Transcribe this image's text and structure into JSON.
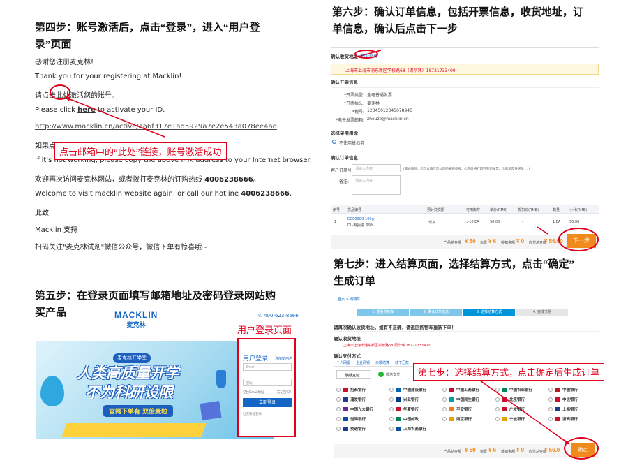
{
  "left": {
    "step4_heading": "第四步：账号激活后，点击“登录”，进入“用户登录”页面",
    "step4_line1": "第四步：账号激活后，点击“登录”，进入“用户登",
    "step4_line2": "录”页面",
    "email": {
      "greeting_cn": "感谢您注册麦克林!",
      "greeting_en": "Thank you for your registering at Macklin!",
      "click_cn_pre": "请点击",
      "click_cn_link": "此处",
      "click_cn_post": "激活您的账号。",
      "click_en_pre": "Please click ",
      "click_en_link": "here",
      "click_en_post": " to activate your ID.",
      "activation_url": "http://www.macklin.cn/active/ea6f317e1ad5929a7e2e543a078ee4ad",
      "fallback_cn": "如果点击无效，请将上述的链接复制至浏览器。",
      "fallback_en": "If it's not working, please copy the above link address to your Internet browser.",
      "welcome_cn_pre": "欢迎再次访问麦克林网站，或者拨打麦克林的订购热线 ",
      "hotline": "4006238666",
      "welcome_cn_post": "。",
      "welcome_en_pre": "Welcome to visit macklin website again, or call our hotline ",
      "welcome_en_post": ".",
      "regards": "此致",
      "signature": "Macklin 支持",
      "wechat": "扫码关注\"麦克林试剂\"微信公众号，微信下单有惊喜哦~"
    },
    "annotation_activate": "点击邮箱中的“此处”链接，账号激活成功",
    "step5_line1": "第五步：在登录页面填写邮箱地址及密码登录网站购",
    "step5_line2": "买产品",
    "login_page": {
      "annotation": "用户登录页面",
      "logo_en": "MACKLIN",
      "logo_cn": "麦克林",
      "phone": "400-623-8666",
      "banner_line1": "人类高质量开学",
      "banner_line2": "不为科研设限",
      "banner_badge": "麦克林开学季",
      "banner_sub": "官网下单有 双倍麦粒",
      "form_title": "用户登录",
      "register_link": "注册新用户",
      "email_placeholder": "Email",
      "password_placeholder": "密码",
      "remember": "记住Email地址",
      "forgot": "忘记密码?",
      "login_button": "立即登录",
      "other_login": "社交账号登录"
    }
  },
  "right": {
    "step6_line1": "第六步：确认订单信息，包括开票信息，收货地址，订",
    "step6_line2": "单信息，确认后点击下一步",
    "order": {
      "address_title": "确认收货地址",
      "address_manage": "+地址管理",
      "address_text": "上海市上海市浦东新区学校路68（周华玮）18721733400",
      "invoice_title": "确认开票信息",
      "invoice_rows": [
        {
          "label": "*开票类型:",
          "value": "全电普通发票"
        },
        {
          "label": "*开票抬头:",
          "value": "麦克林"
        },
        {
          "label": "*税号:",
          "value": "12345012345678945"
        },
        {
          "label": "*电子发票邮箱:",
          "value": "zhouze@macklin.cn"
        }
      ],
      "use_title": "选择采用用途",
      "use_option": "不使用抵扣劵",
      "confirm_title": "确认订单信息",
      "customer_no_label": "客户订单号:",
      "customer_no_placeholder": "请输入内容",
      "customer_no_hint": "(非必填项，您可以填写您公司的采购单号，此字段将打印在我司发票、出库单及快递单上。)",
      "remark_label": "备注:",
      "remark_placeholder": "请输入内容",
      "table_headers": [
        "序号",
        "货品编号",
        "预计交货期",
        "可用库存",
        "单价(RMB)",
        "折扣价(RMB)",
        "数量",
        "小计(RMB)"
      ],
      "table_row": [
        "1",
        "D0000C0-100g",
        "现货",
        ">10 EA",
        "50.00",
        "-",
        "1 EA",
        "50.00"
      ],
      "product_name": "DL-丙氨酸, 99%",
      "summary": {
        "product_total_label": "产品总金额",
        "product_total": "50",
        "shipping_label": "运费",
        "shipping": "6",
        "discount_label": "抵扣金额",
        "discount": "0",
        "payable_label": "应付总金额",
        "payable": "56.00"
      },
      "next_button": "下一步"
    },
    "step7_line1": "第七步：进入结算页面，选择结算方式，点击“确定”",
    "step7_line2": "生成订单",
    "checkout": {
      "breadcrumb": [
        "首页",
        "购物车"
      ],
      "progress_steps": [
        "1. 查看购物车",
        "2. 确认订单信息",
        "3. 选择结算方式",
        "4. 完成交易"
      ],
      "notice": "请再次确认收货地址，如有不正确，请返回购物车重新下单！",
      "address_title": "确认收货地址",
      "address_text": "上海市上海市浦东新区学校路68 周华玮 18721733400",
      "pay_title": "确认支付方式",
      "tabs": [
        "个人网银",
        "企业网银",
        "余额结算",
        "线下汇款"
      ],
      "methods": [
        "快钱支付",
        "微信支付"
      ],
      "banks": [
        "招商银行",
        "中国建设银行",
        "中国工商银行",
        "中国农业银行",
        "中国银行",
        "浦发银行",
        "兴业银行",
        "中国民生银行",
        "北京银行",
        "中信银行",
        "中国光大银行",
        "华夏银行",
        "平安银行",
        "广发银行",
        "上海银行",
        "渤海银行",
        "中国邮政",
        "南京银行",
        "宁波银行",
        "浙商银行",
        "交通银行",
        "上海农商银行"
      ],
      "summary": {
        "product_total_label": "产品总金额",
        "product_total": "50",
        "shipping_label": "运费",
        "shipping": "6",
        "discount_label": "抵扣金额",
        "discount": "0",
        "payable_label": "应付总金额",
        "payable": "56.0"
      },
      "confirm_button": "确定"
    },
    "annotation_pay": "第七步：选择结算方式，点击确定后生成订单"
  },
  "colors": {
    "accent_red": "#e0001b",
    "orange": "#f08a1c",
    "macklin_blue": "#1466c4",
    "progress_blue": "#0095d9"
  }
}
